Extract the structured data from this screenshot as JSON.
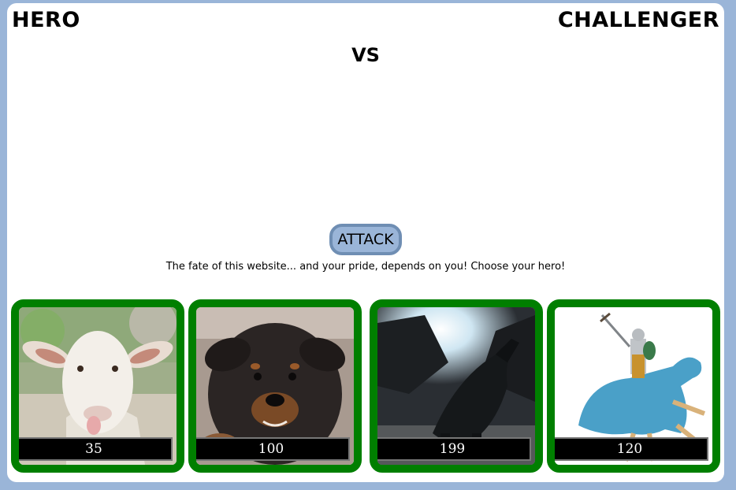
{
  "arena": {
    "hero_label": "HERO",
    "challenger_label": "CHALLENGER",
    "vs_label": "VS"
  },
  "controls": {
    "attack_label": "ATTACK"
  },
  "message": "The fate of this website... and your pride, depends on you! Choose your hero!",
  "characters": [
    {
      "portrait": "sheep",
      "hp": "35"
    },
    {
      "portrait": "puppy",
      "hp": "100"
    },
    {
      "portrait": "dragon",
      "hp": "199"
    },
    {
      "portrait": "knight",
      "hp": "120"
    }
  ],
  "colors": {
    "page_background": "#9ab5d8",
    "card_border": "#007f00",
    "attack_button_fill": "#9ab5d8",
    "attack_button_border": "#6f8eb3",
    "hp_bar": "#000000"
  }
}
